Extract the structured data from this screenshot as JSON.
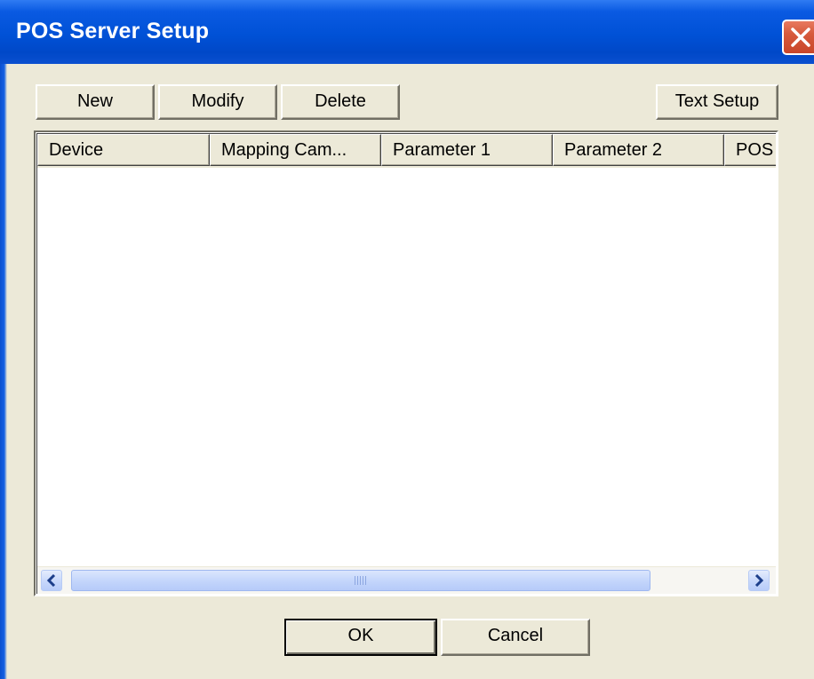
{
  "window": {
    "title": "POS Server Setup"
  },
  "toolbar": {
    "new_label": "New",
    "modify_label": "Modify",
    "delete_label": "Delete",
    "text_setup_label": "Text Setup"
  },
  "table": {
    "columns": [
      "Device",
      "Mapping Cam...",
      "Parameter 1",
      "Parameter 2",
      "POS"
    ],
    "rows": []
  },
  "footer": {
    "ok_label": "OK",
    "cancel_label": "Cancel"
  },
  "icons": {
    "close": "close-icon",
    "scroll_left": "chevron-left-icon",
    "scroll_right": "chevron-right-icon",
    "scroll_grip": "grip-icon"
  },
  "colors": {
    "titlebar": "#0051d6",
    "close_button": "#d65a3c",
    "dialog_background": "#ece9d8",
    "scrollbar_accent": "#c3d5fb"
  }
}
